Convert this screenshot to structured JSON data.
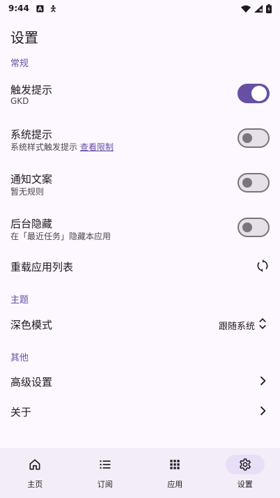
{
  "status_bar": {
    "time": "9:44"
  },
  "page": {
    "title": "设置"
  },
  "sections": {
    "general": "常规",
    "theme": "主题",
    "other": "其他"
  },
  "settings": {
    "trigger_hint": {
      "title": "触发提示",
      "subtitle": "GKD",
      "enabled": true
    },
    "system_hint": {
      "title": "系统提示",
      "subtitle": "系统样式触发提示",
      "link": "查看限制",
      "enabled": false
    },
    "notification_text": {
      "title": "通知文案",
      "subtitle": "暂无规则",
      "enabled": false
    },
    "background_hide": {
      "title": "后台隐藏",
      "subtitle": "在「最近任务」隐藏本应用",
      "enabled": false
    },
    "reload_apps": {
      "title": "重载应用列表",
      "icon": "refresh-icon"
    },
    "dark_mode": {
      "title": "深色模式",
      "value": "跟随系统",
      "icon": "unfold-icon"
    },
    "advanced": {
      "title": "高级设置",
      "icon": "chevron-right-icon"
    },
    "about": {
      "title": "关于",
      "icon": "chevron-right-icon"
    }
  },
  "bottom_nav": [
    {
      "label": "主页",
      "icon": "home-icon",
      "active": false
    },
    {
      "label": "订阅",
      "icon": "list-icon",
      "active": false
    },
    {
      "label": "应用",
      "icon": "apps-grid-icon",
      "active": false
    },
    {
      "label": "设置",
      "icon": "gear-icon",
      "active": true
    }
  ],
  "colors": {
    "background": "#fdf7ff",
    "accent": "#6750a4",
    "nav_background": "#f3edf7",
    "active_pill": "#e8def8"
  }
}
